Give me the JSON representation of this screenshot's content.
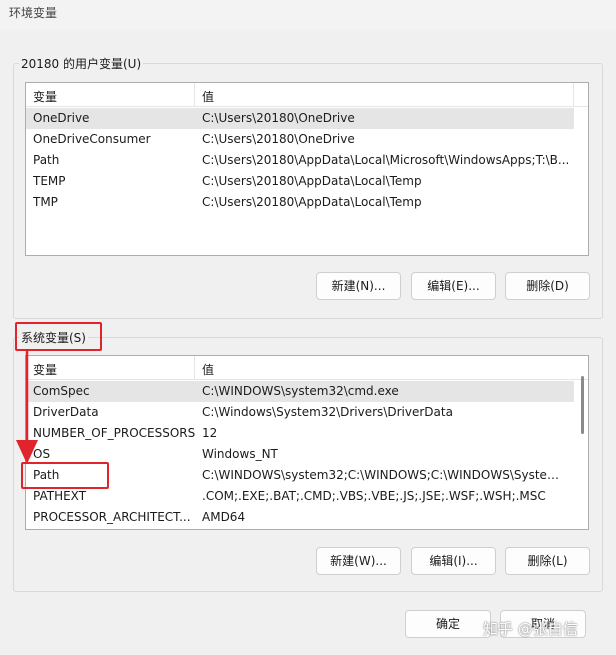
{
  "window": {
    "title": "环境变量"
  },
  "user_vars": {
    "group_label": "20180 的用户变量(U)",
    "columns": [
      "变量",
      "值"
    ],
    "rows": [
      {
        "name": "OneDrive",
        "value": "C:\\Users\\20180\\OneDrive"
      },
      {
        "name": "OneDriveConsumer",
        "value": "C:\\Users\\20180\\OneDrive"
      },
      {
        "name": "Path",
        "value": "C:\\Users\\20180\\AppData\\Local\\Microsoft\\WindowsApps;T:\\B..."
      },
      {
        "name": "TEMP",
        "value": "C:\\Users\\20180\\AppData\\Local\\Temp"
      },
      {
        "name": "TMP",
        "value": "C:\\Users\\20180\\AppData\\Local\\Temp"
      }
    ],
    "new_label": "新建(N)...",
    "edit_label": "编辑(E)...",
    "delete_label": "删除(D)"
  },
  "system_vars": {
    "group_label": "系统变量(S)",
    "columns": [
      "变量",
      "值"
    ],
    "rows": [
      {
        "name": "ComSpec",
        "value": "C:\\WINDOWS\\system32\\cmd.exe"
      },
      {
        "name": "DriverData",
        "value": "C:\\Windows\\System32\\Drivers\\DriverData"
      },
      {
        "name": "NUMBER_OF_PROCESSORS",
        "value": "12"
      },
      {
        "name": "OS",
        "value": "Windows_NT"
      },
      {
        "name": "Path",
        "value": "C:\\WINDOWS\\system32;C:\\WINDOWS;C:\\WINDOWS\\System..."
      },
      {
        "name": "PATHEXT",
        "value": ".COM;.EXE;.BAT;.CMD;.VBS;.VBE;.JS;.JSE;.WSF;.WSH;.MSC"
      },
      {
        "name": "PROCESSOR_ARCHITECT...",
        "value": "AMD64"
      }
    ],
    "new_label": "新建(W)...",
    "edit_label": "编辑(I)...",
    "delete_label": "删除(L)"
  },
  "footer": {
    "ok_label": "确定",
    "cancel_label": "取消"
  },
  "watermark": "知乎 @张自信",
  "colors": {
    "annotation": "#e0242c",
    "selected_row": "#e5e5e5"
  }
}
